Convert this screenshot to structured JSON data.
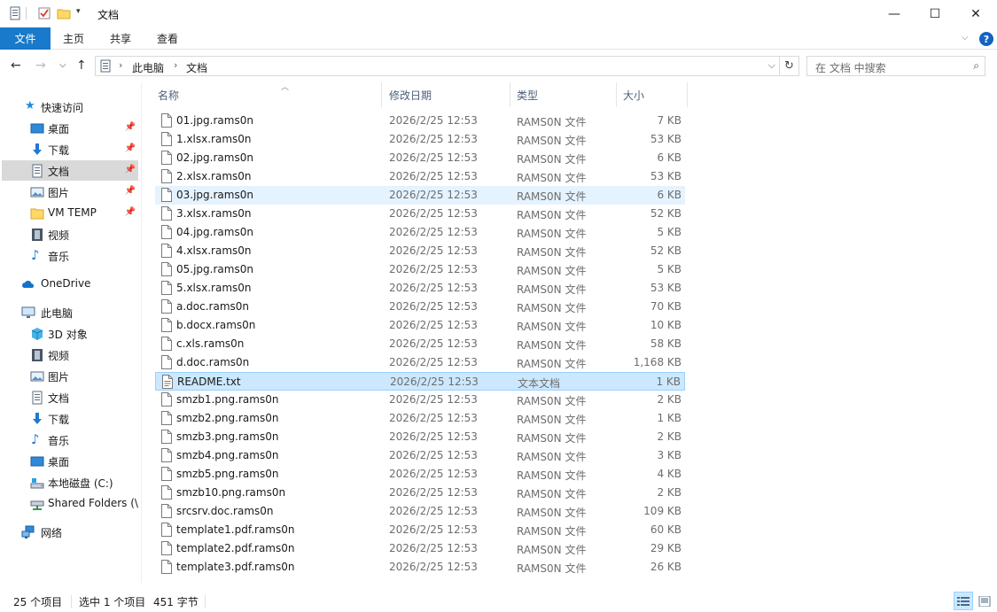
{
  "window": {
    "title": "文档",
    "minimize": "—",
    "maximize": "☐",
    "close": "✕"
  },
  "ribbon": {
    "tabs": [
      "文件",
      "主页",
      "共享",
      "查看"
    ],
    "help": "?"
  },
  "address": {
    "crumbs": [
      "此电脑",
      "文档"
    ],
    "search_placeholder": "在 文档 中搜索"
  },
  "nav": {
    "items": [
      {
        "label": "快速访问",
        "icon": "star-icon"
      },
      {
        "label": "桌面",
        "icon": "desktop-icon",
        "pinned": true
      },
      {
        "label": "下载",
        "icon": "download-icon",
        "pinned": true
      },
      {
        "label": "文档",
        "icon": "document-icon",
        "pinned": true,
        "selected": true
      },
      {
        "label": "图片",
        "icon": "pictures-icon",
        "pinned": true
      },
      {
        "label": "VM TEMP",
        "icon": "folder-icon",
        "pinned": true
      },
      {
        "label": "视频",
        "icon": "video-icon"
      },
      {
        "label": "音乐",
        "icon": "music-icon"
      },
      {
        "label": "OneDrive",
        "icon": "cloud-icon"
      },
      {
        "label": "此电脑",
        "icon": "computer-icon"
      },
      {
        "label": "3D 对象",
        "icon": "3d-objects-icon"
      },
      {
        "label": "视频",
        "icon": "video-icon"
      },
      {
        "label": "图片",
        "icon": "pictures-icon"
      },
      {
        "label": "文档",
        "icon": "document-icon"
      },
      {
        "label": "下载",
        "icon": "download-icon"
      },
      {
        "label": "音乐",
        "icon": "music-icon"
      },
      {
        "label": "桌面",
        "icon": "desktop-icon"
      },
      {
        "label": "本地磁盘 (C:)",
        "icon": "drive-icon"
      },
      {
        "label": "Shared Folders (\\\\",
        "icon": "network-drive-icon"
      },
      {
        "label": "网络",
        "icon": "network-icon"
      }
    ]
  },
  "columns": {
    "name": "名称",
    "date": "修改日期",
    "type": "类型",
    "size": "大小"
  },
  "files": [
    {
      "name": "01.jpg.rams0n",
      "date": "2026/2/25 12:53",
      "type": "RAMS0N 文件",
      "size": "7 KB"
    },
    {
      "name": "1.xlsx.rams0n",
      "date": "2026/2/25 12:53",
      "type": "RAMS0N 文件",
      "size": "53 KB"
    },
    {
      "name": "02.jpg.rams0n",
      "date": "2026/2/25 12:53",
      "type": "RAMS0N 文件",
      "size": "6 KB"
    },
    {
      "name": "2.xlsx.rams0n",
      "date": "2026/2/25 12:53",
      "type": "RAMS0N 文件",
      "size": "53 KB"
    },
    {
      "name": "03.jpg.rams0n",
      "date": "2026/2/25 12:53",
      "type": "RAMS0N 文件",
      "size": "6 KB",
      "state": "hover"
    },
    {
      "name": "3.xlsx.rams0n",
      "date": "2026/2/25 12:53",
      "type": "RAMS0N 文件",
      "size": "52 KB"
    },
    {
      "name": "04.jpg.rams0n",
      "date": "2026/2/25 12:53",
      "type": "RAMS0N 文件",
      "size": "5 KB"
    },
    {
      "name": "4.xlsx.rams0n",
      "date": "2026/2/25 12:53",
      "type": "RAMS0N 文件",
      "size": "52 KB"
    },
    {
      "name": "05.jpg.rams0n",
      "date": "2026/2/25 12:53",
      "type": "RAMS0N 文件",
      "size": "5 KB"
    },
    {
      "name": "5.xlsx.rams0n",
      "date": "2026/2/25 12:53",
      "type": "RAMS0N 文件",
      "size": "53 KB"
    },
    {
      "name": "a.doc.rams0n",
      "date": "2026/2/25 12:53",
      "type": "RAMS0N 文件",
      "size": "70 KB"
    },
    {
      "name": "b.docx.rams0n",
      "date": "2026/2/25 12:53",
      "type": "RAMS0N 文件",
      "size": "10 KB"
    },
    {
      "name": "c.xls.rams0n",
      "date": "2026/2/25 12:53",
      "type": "RAMS0N 文件",
      "size": "58 KB"
    },
    {
      "name": "d.doc.rams0n",
      "date": "2026/2/25 12:53",
      "type": "RAMS0N 文件",
      "size": "1,168 KB"
    },
    {
      "name": "README.txt",
      "date": "2026/2/25 12:53",
      "type": "文本文档",
      "size": "1 KB",
      "state": "selected",
      "icon": "text-file-icon"
    },
    {
      "name": "smzb1.png.rams0n",
      "date": "2026/2/25 12:53",
      "type": "RAMS0N 文件",
      "size": "2 KB"
    },
    {
      "name": "smzb2.png.rams0n",
      "date": "2026/2/25 12:53",
      "type": "RAMS0N 文件",
      "size": "1 KB"
    },
    {
      "name": "smzb3.png.rams0n",
      "date": "2026/2/25 12:53",
      "type": "RAMS0N 文件",
      "size": "2 KB"
    },
    {
      "name": "smzb4.png.rams0n",
      "date": "2026/2/25 12:53",
      "type": "RAMS0N 文件",
      "size": "3 KB"
    },
    {
      "name": "smzb5.png.rams0n",
      "date": "2026/2/25 12:53",
      "type": "RAMS0N 文件",
      "size": "4 KB"
    },
    {
      "name": "smzb10.png.rams0n",
      "date": "2026/2/25 12:53",
      "type": "RAMS0N 文件",
      "size": "2 KB"
    },
    {
      "name": "srcsrv.doc.rams0n",
      "date": "2026/2/25 12:53",
      "type": "RAMS0N 文件",
      "size": "109 KB"
    },
    {
      "name": "template1.pdf.rams0n",
      "date": "2026/2/25 12:53",
      "type": "RAMS0N 文件",
      "size": "60 KB"
    },
    {
      "name": "template2.pdf.rams0n",
      "date": "2026/2/25 12:53",
      "type": "RAMS0N 文件",
      "size": "29 KB"
    },
    {
      "name": "template3.pdf.rams0n",
      "date": "2026/2/25 12:53",
      "type": "RAMS0N 文件",
      "size": "26 KB"
    }
  ],
  "status": {
    "count": "25 个项目",
    "selection": "选中 1 个项目",
    "selection_size": "451 字节"
  },
  "colors": {
    "accent": "#1979ca",
    "selected_row": "#cce8ff",
    "hover_row": "#e5f3ff"
  }
}
